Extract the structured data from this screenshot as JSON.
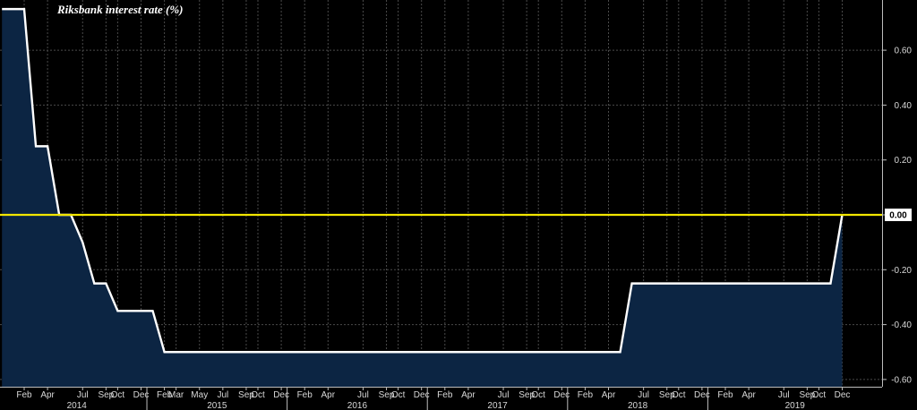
{
  "chart_data": {
    "type": "area",
    "title": "Riksbank interest rate (%)",
    "xlabel": "",
    "ylabel": "",
    "ylim": [
      -0.62,
      0.78
    ],
    "yticks": [
      0.6,
      0.4,
      0.2,
      0.0,
      -0.2,
      -0.4,
      -0.6
    ],
    "ytick_labels": [
      "0.60",
      "0.40",
      "0.20",
      "0.00",
      "-0.20",
      "-0.40",
      "-0.60"
    ],
    "highlighted_ytick": "0.00",
    "x_tick_labels": [
      "Feb",
      "Apr",
      "Jul",
      "Sep",
      "Oct",
      "Dec",
      "Feb",
      "Mar",
      "May",
      "Jul",
      "Sep",
      "Oct",
      "Dec",
      "Feb",
      "Apr",
      "Jul",
      "Sep",
      "Oct",
      "Dec",
      "Feb",
      "Apr",
      "Jul",
      "Sep",
      "Oct",
      "Dec",
      "Feb",
      "Apr",
      "Jul",
      "Sep",
      "Oct",
      "Dec",
      "Feb",
      "Apr",
      "Jul",
      "Sep",
      "Oct",
      "Dec"
    ],
    "x_tick_months": [
      2,
      4,
      7,
      9,
      10,
      12,
      14,
      15,
      17,
      19,
      21,
      22,
      24,
      26,
      28,
      31,
      33,
      34,
      36,
      38,
      40,
      43,
      45,
      46,
      48,
      50,
      52,
      55,
      57,
      58,
      60,
      62,
      64,
      67,
      69,
      70,
      72
    ],
    "years": [
      "2014",
      "2015",
      "2016",
      "2017",
      "2018",
      "2019"
    ],
    "year_start_months": [
      1,
      13,
      25,
      37,
      49,
      61
    ],
    "x_range_months": [
      0.1,
      72.6
    ],
    "grid": true,
    "series": [
      {
        "values_x_months": [
          0.1,
          2.0,
          3.0,
          4.0,
          5.0,
          6.0,
          7.0,
          8.0,
          9.0,
          10.0,
          11.0,
          13.0,
          14.0,
          15.0,
          16.0,
          19.0,
          20.0,
          22.0,
          23.0,
          53.0,
          54.0,
          59.0,
          60.0,
          70.0,
          71.0,
          72.0
        ],
        "values_y": [
          0.75,
          0.75,
          0.25,
          0.25,
          0.0,
          0.0,
          -0.1,
          -0.25,
          -0.25,
          -0.35,
          -0.35,
          -0.35,
          -0.5,
          -0.5,
          -0.5,
          -0.5,
          -0.5,
          -0.5,
          -0.5,
          -0.5,
          -0.25,
          -0.25,
          -0.25,
          -0.25,
          -0.25,
          0.0
        ],
        "line_color": "#ffffff",
        "fill_color": "#0c2543"
      }
    ],
    "reference_line": {
      "y": 0.0,
      "color": "#f2e600"
    }
  }
}
